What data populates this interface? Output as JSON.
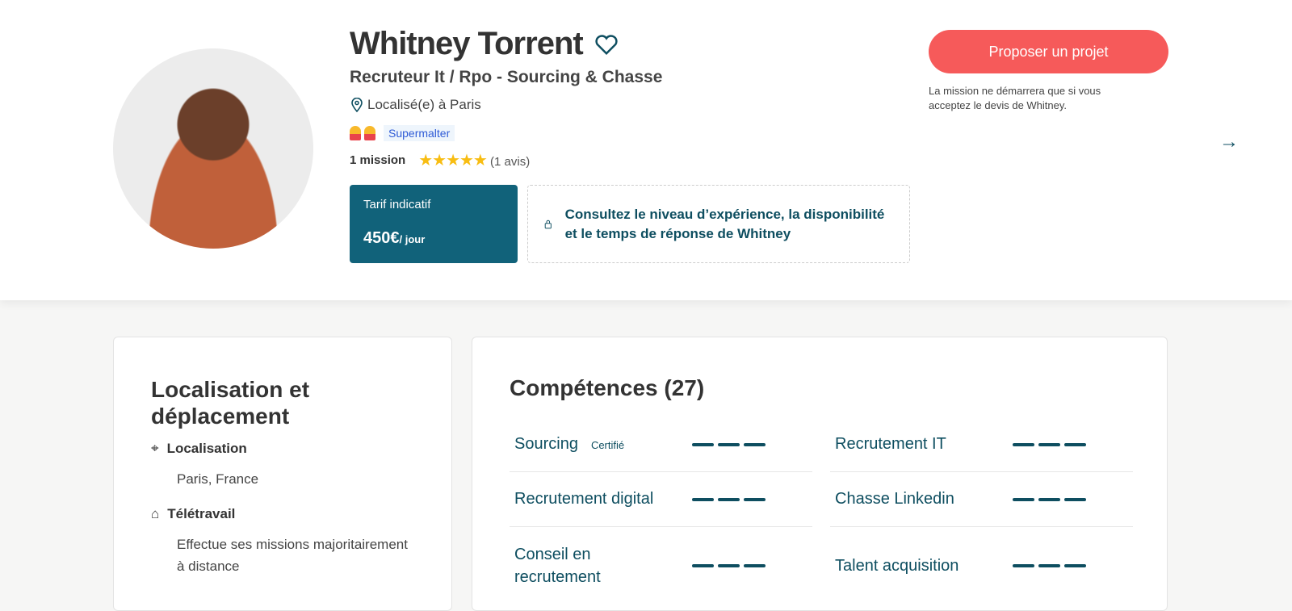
{
  "profile": {
    "name": "Whitney Torrent",
    "title": "Recruteur It / Rpo - Sourcing & Chasse",
    "location": "Localisé(e) à Paris",
    "badge": "Supermalter",
    "missions": "1 mission",
    "rating": 5,
    "reviews": "(1 avis)"
  },
  "tarif": {
    "label": "Tarif indicatif",
    "price": "450€",
    "unit": "/ jour"
  },
  "locked": "Consultez le niveau d’expérience, la disponibilité et le temps de réponse de Whitney",
  "cta": {
    "label": "Proposer un projet",
    "note": "La mission ne démarrera que si vous acceptez le devis de Whitney."
  },
  "location_card": {
    "title": "Localisation et déplacement",
    "loc_label": "Localisation",
    "loc_value": "Paris, France",
    "remote_label": "Télétravail",
    "remote_value": "Effectue ses missions majoritairement à distance"
  },
  "skills": {
    "title": "Compétences (27)",
    "items": [
      {
        "name": "Sourcing",
        "cert": "Certifié"
      },
      {
        "name": "Recrutement IT",
        "cert": ""
      },
      {
        "name": "Recrutement digital",
        "cert": ""
      },
      {
        "name": "Chasse Linkedin",
        "cert": ""
      },
      {
        "name": "Conseil en recrutement",
        "cert": ""
      },
      {
        "name": "Talent acquisition",
        "cert": ""
      }
    ]
  },
  "colors": {
    "primary": "#0e4e60",
    "accent": "#f65a5a"
  }
}
